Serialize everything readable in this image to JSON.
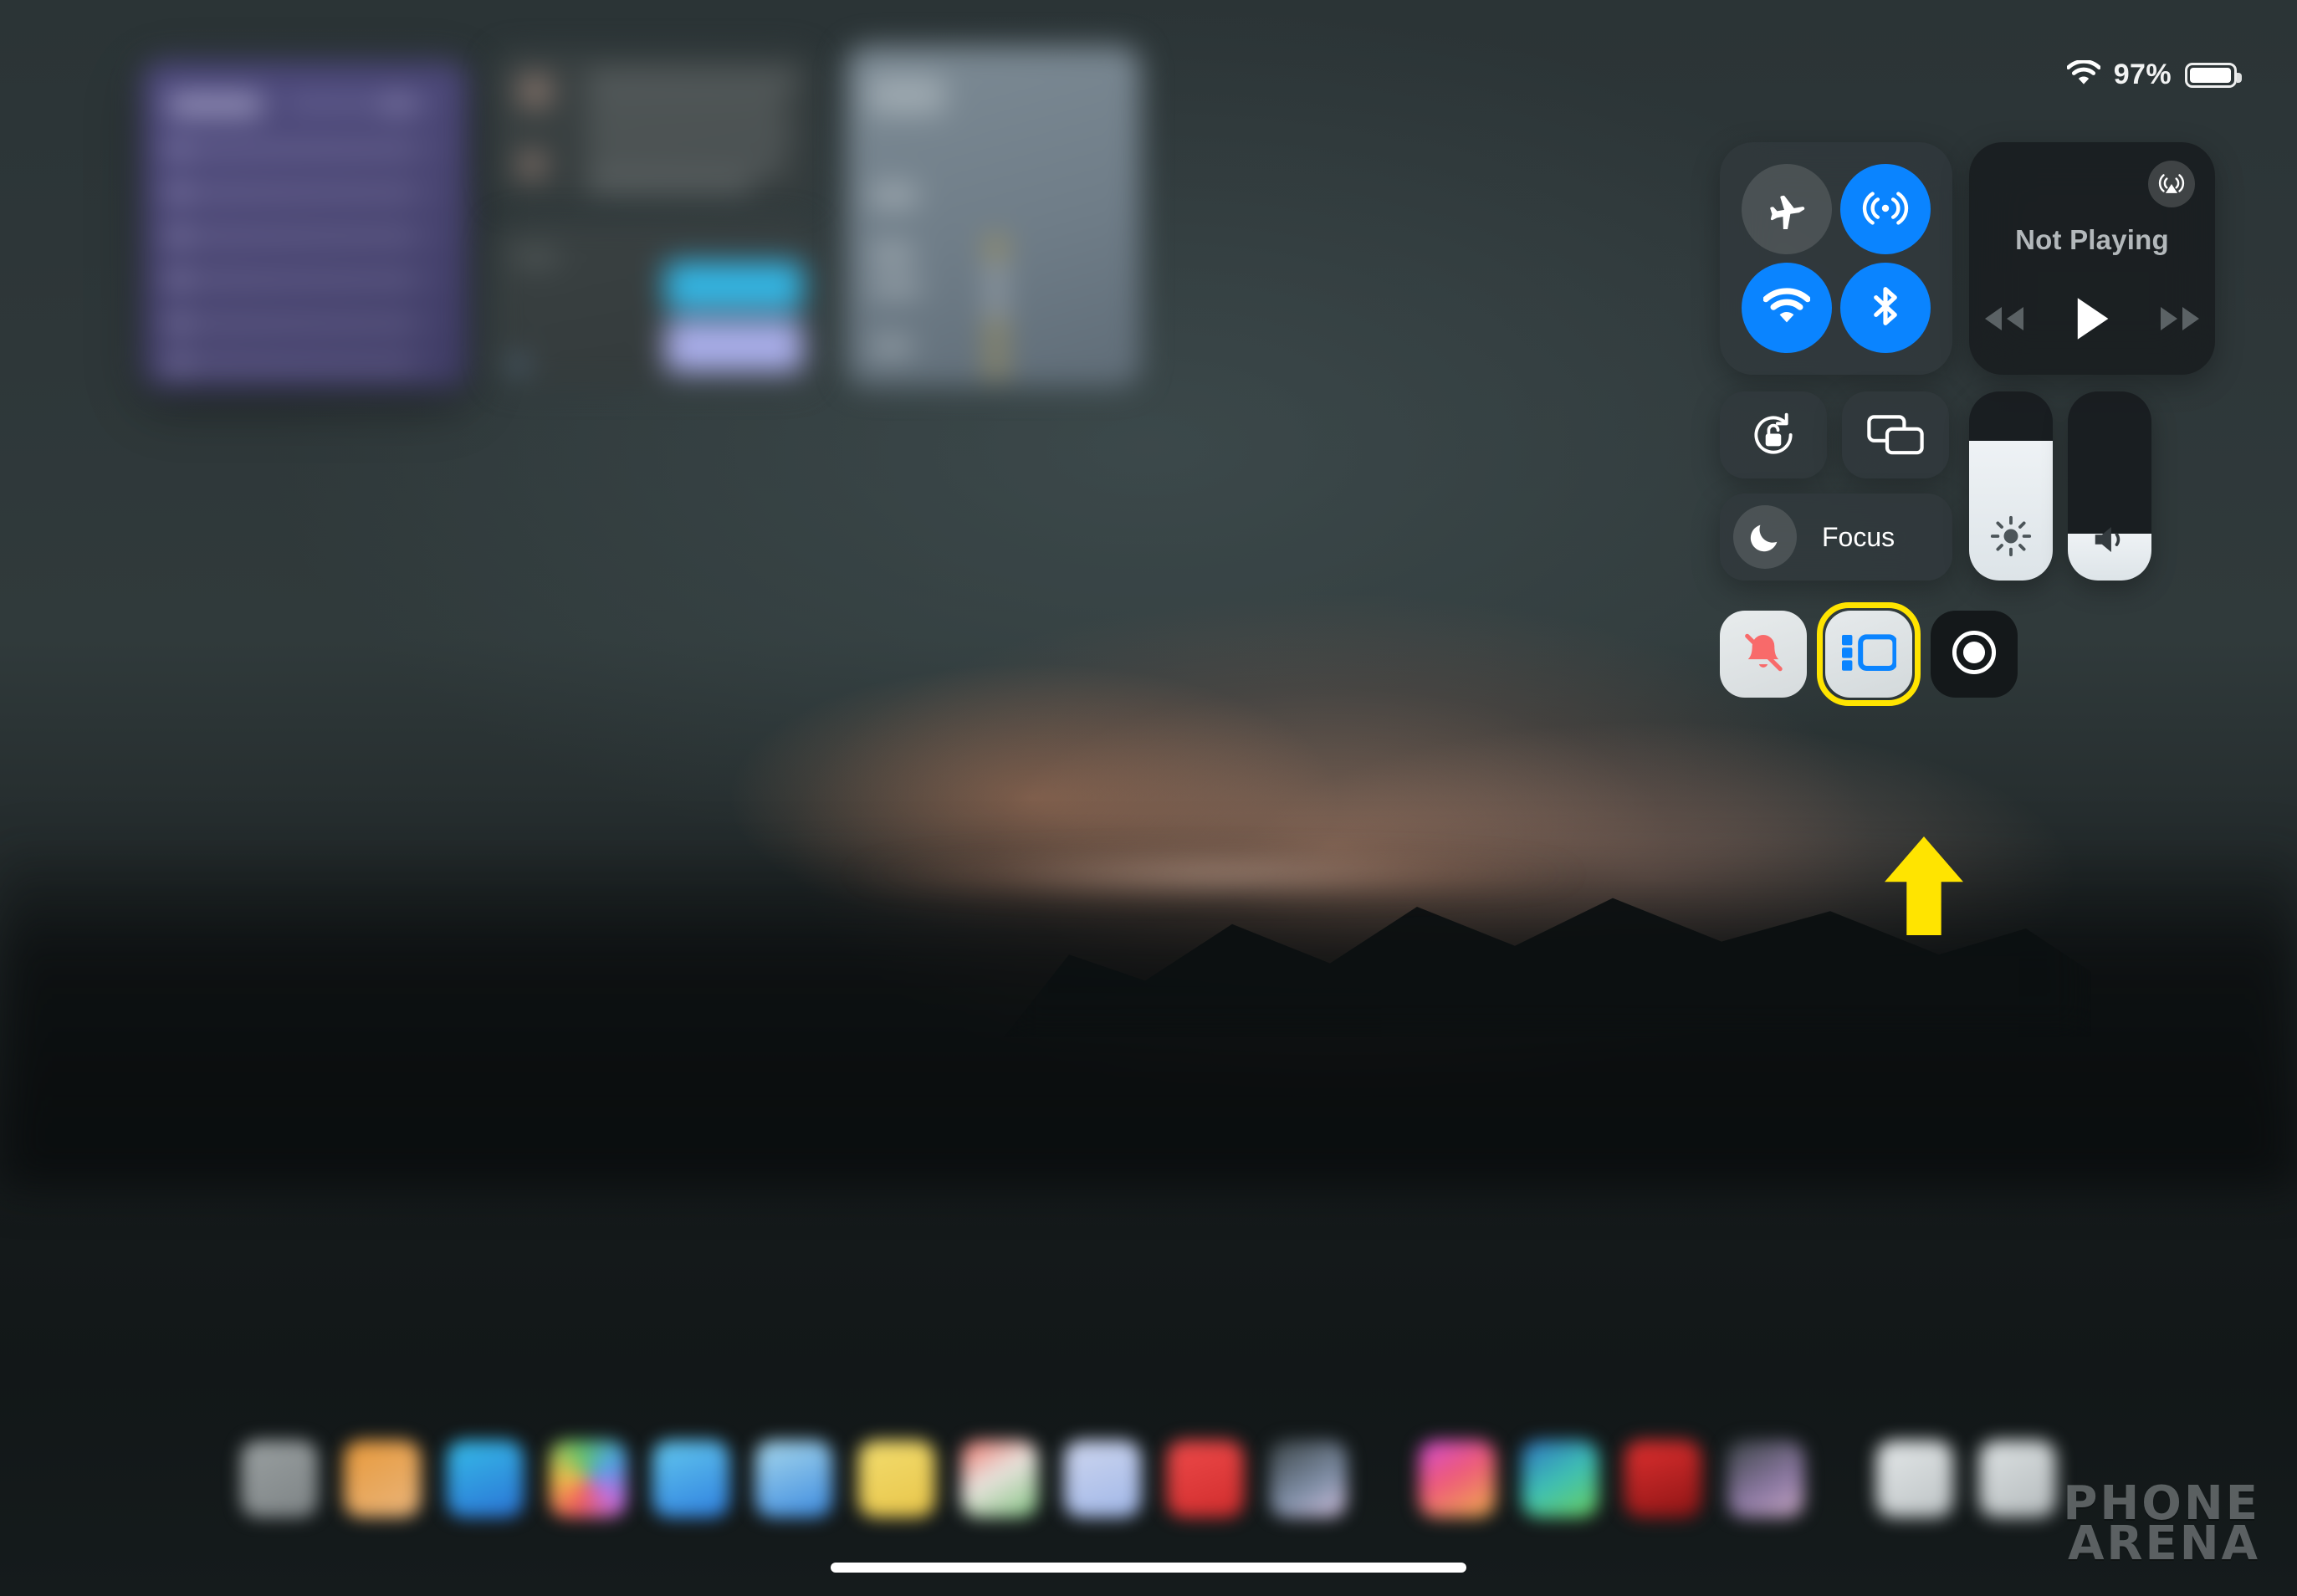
{
  "status_bar": {
    "wifi_icon": "wifi-icon",
    "battery_percent": "97%",
    "battery_icon": "battery-full-icon",
    "battery_level": 97
  },
  "control_center": {
    "connectivity": {
      "airplane_mode": {
        "name": "Airplane Mode",
        "icon": "airplane-icon",
        "state": "off"
      },
      "airdrop": {
        "name": "AirDrop",
        "icon": "airdrop-icon",
        "state": "on"
      },
      "wifi": {
        "name": "Wi-Fi",
        "icon": "wifi-icon",
        "state": "on"
      },
      "bluetooth": {
        "name": "Bluetooth",
        "icon": "bluetooth-icon",
        "state": "on"
      }
    },
    "media": {
      "title": "Not Playing",
      "airplay_icon": "airplay-audio-icon",
      "rewind_icon": "rewind-icon",
      "play_icon": "play-icon",
      "forward_icon": "fast-forward-icon"
    },
    "rotation_lock": {
      "name": "Rotation Lock",
      "icon": "rotation-lock-icon",
      "state": "off"
    },
    "screen_mirroring": {
      "name": "Screen Mirroring",
      "icon": "screen-mirroring-icon",
      "state": "off"
    },
    "focus": {
      "label": "Focus",
      "icon": "moon-icon",
      "state": "off"
    },
    "brightness": {
      "name": "Brightness",
      "icon": "brightness-icon",
      "value": 74
    },
    "volume": {
      "name": "Volume",
      "icon": "speaker-icon",
      "value": 25
    },
    "silent_mode": {
      "name": "Silent Mode",
      "icon": "bell-slash-icon",
      "state": "on"
    },
    "stage_manager": {
      "name": "Stage Manager",
      "icon": "stage-manager-icon",
      "state": "on",
      "highlighted": true
    },
    "screen_record": {
      "name": "Screen Recording",
      "icon": "record-icon",
      "state": "off"
    }
  },
  "annotation": {
    "arrow": "up-arrow-pointing-to-stage-manager",
    "color": "#ffe400"
  },
  "dock": {
    "icons": [
      "app-icon-files",
      "app-icon-orange",
      "app-icon-blue",
      "app-icon-photos",
      "app-icon-safari",
      "app-icon-cyan",
      "app-icon-notes",
      "app-icon-appstore",
      "app-icon-lavender",
      "app-icon-youtube",
      "app-icon-freeform",
      "app-icon-magenta",
      "app-icon-fitness",
      "app-icon-red",
      "app-icon-keynote",
      "app-icon-gray1",
      "app-icon-gray2"
    ]
  },
  "home_indicator": {
    "name": "home-indicator"
  },
  "watermark": {
    "line1": "PHONE",
    "line2": "ARENA"
  }
}
